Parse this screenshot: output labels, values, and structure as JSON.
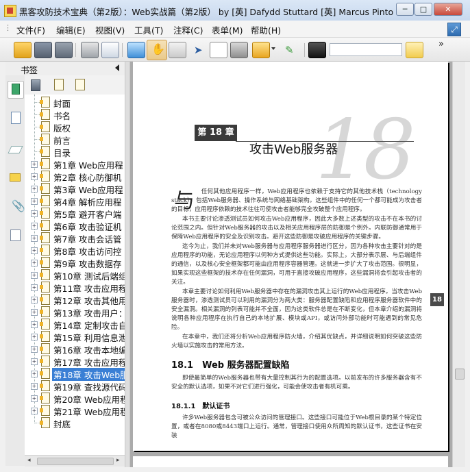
{
  "window": {
    "title": "黑客攻防技术宝典（第2版）：Web实战篇（第2版） by [英] Dafydd Stuttard  [英] Marcus Pinto ...",
    "minimize": "─",
    "maximize": "□",
    "close": "✕"
  },
  "menu": [
    "文件(F)",
    "编辑(E)",
    "视图(V)",
    "工具(T)",
    "注释(C)",
    "表单(M)",
    "帮助(H)"
  ],
  "toolbar": {
    "icons": [
      "open-folder-icon",
      "save-icon",
      "save-copy-icon",
      "print-icon",
      "email-icon",
      "screen-icon",
      "hand-tool-icon",
      "zoom-icon",
      "select-arrow-icon",
      "text-select-icon",
      "snapshot-icon",
      "rights-icon",
      "sign-icon",
      "find-icon"
    ],
    "more": "»"
  },
  "bookmarks": {
    "title": "书签",
    "items": [
      {
        "label": "封面",
        "expandable": false
      },
      {
        "label": "书名",
        "expandable": false
      },
      {
        "label": "版权",
        "expandable": false
      },
      {
        "label": "前言",
        "expandable": false
      },
      {
        "label": "目录",
        "expandable": false
      },
      {
        "label": "第1章 Web应用程",
        "expandable": true
      },
      {
        "label": "第2章 核心防御机",
        "expandable": true
      },
      {
        "label": "第3章 Web应用程",
        "expandable": true
      },
      {
        "label": "第4章 解析应用程",
        "expandable": true
      },
      {
        "label": "第5章 避开客户端",
        "expandable": true
      },
      {
        "label": "第6章 攻击验证机",
        "expandable": true
      },
      {
        "label": "第7章 攻击会话管",
        "expandable": true
      },
      {
        "label": "第8章 攻击访问控",
        "expandable": true
      },
      {
        "label": "第9章 攻击数据存",
        "expandable": true
      },
      {
        "label": "第10章 测试后端组",
        "expandable": true
      },
      {
        "label": "第11章 攻击应用程",
        "expandable": true
      },
      {
        "label": "第12章 攻击其他用",
        "expandable": true
      },
      {
        "label": "第13章 攻击用户：",
        "expandable": true
      },
      {
        "label": "第14章 定制攻击自",
        "expandable": true
      },
      {
        "label": "第15章 利用信息泄",
        "expandable": true
      },
      {
        "label": "第16章 攻击本地编",
        "expandable": true
      },
      {
        "label": "第17章 攻击应用程",
        "expandable": true
      },
      {
        "label": "第18章 攻击Web服",
        "expandable": true,
        "selected": true
      },
      {
        "label": "第19章 查找源代码",
        "expandable": true
      },
      {
        "label": "第20章 Web应用程",
        "expandable": true
      },
      {
        "label": "第21章 Web应用程",
        "expandable": true
      },
      {
        "label": "封底",
        "expandable": false
      }
    ]
  },
  "page": {
    "chapter_label": "第 18 章",
    "chapter_number": "18",
    "chapter_title": "攻击Web服务器",
    "drop_cap": "与",
    "paragraphs": [
      "　　任何其他应用程序一样，Web应用程序也依赖于支持它的其他技术栈（technology stack），包括Web服务器、操作系统与网络基础架构。这些组件中的任何一个都可能成为攻击者的目标，应用程序依赖的技术往往可使攻击者能够完全攻破整个应用程序。",
      "本书主要讨论渗透测试员如何攻击Web应用程序，因此大多数上述类型的攻击不在本书的讨论范围之内。但针对Web服务器的攻击以及相关应用程序层的防御是个例外。内联防御通常用于保障Web应用程序的安全及识别攻击。避开这些防御是攻破应用程序的关键步骤。",
      "迄今为止，我们并未对Web服务器与应用程序服务器进行区分，因为各种攻击主要针对的是应用程序的功能，无论应用程序以何种方式提供这些功能。实际上，大部分表示层、与后端组件的通信，以及核心安全框架都可能由应用程序容器管理。这就进一步扩大了攻击范围。很明显，如果实现这些框架的技术存在任何漏洞，可用于直接攻破应用程序，这些漏洞将会引起攻击者的关注。",
      "本章主要讨论如何利用Web服务器中存在的漏洞攻击其上运行的Web应用程序。当攻击Web服务器时，渗透测试员可以利用的漏洞分为两大类：服务器配置缺陷和应用程序服务器软件中的安全漏洞。相关漏洞的列表可能并不全面，因为这类软件总是在不断变化，但本章介绍的漏洞将说明各种应用程序在执行自己的本地扩展、模块或API，或访问外部功能时可能遇到的常见危险。",
      "在本章中，我们还将分析Web应用程序防火墙，介绍其优缺点，并详细说明如何突破这些防火墙以实施攻击的常用方法。"
    ],
    "section_heading": "18.1　Web 服务器配置缺陷",
    "section_text": "即使最简单的Web服务器也带有大量控制其行为的配置选项。以前发布的许多服务器含有不安全的默认选项，如果不对它们进行强化，可能会使攻击者有机可乘。",
    "subsection_heading": "18.1.1　默认证书",
    "subsection_text": "许多Web服务器包含可被公众访问的管理接口。这些接口可能位于Web根目录的某个特定位置，或者在8080或8443端口上运行。通常，管理接口使用众所周知的默认证书，这些证书在安装",
    "page_tab": "18"
  }
}
